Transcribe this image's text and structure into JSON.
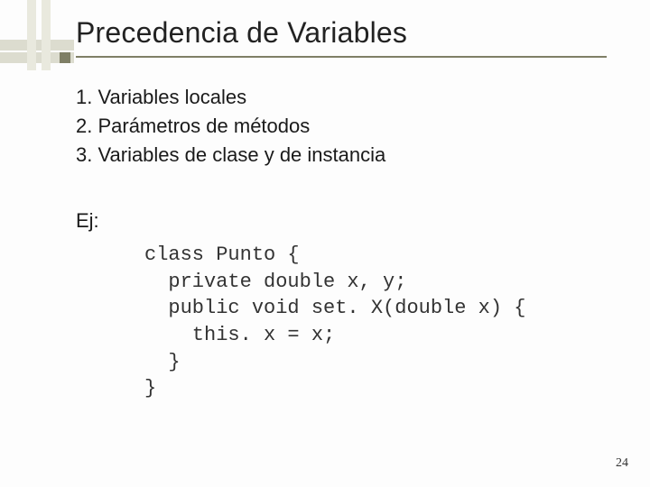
{
  "title": "Precedencia de Variables",
  "list": {
    "items": [
      "1. Variables locales",
      "2. Parámetros de métodos",
      "3. Variables de clase y de instancia"
    ]
  },
  "example_label": "Ej:",
  "code": {
    "lines": [
      "class Punto {",
      "  private double x, y;",
      "  public void set. X(double x) {",
      "    this. x = x;",
      "  }",
      "}"
    ]
  },
  "page_number": "24"
}
